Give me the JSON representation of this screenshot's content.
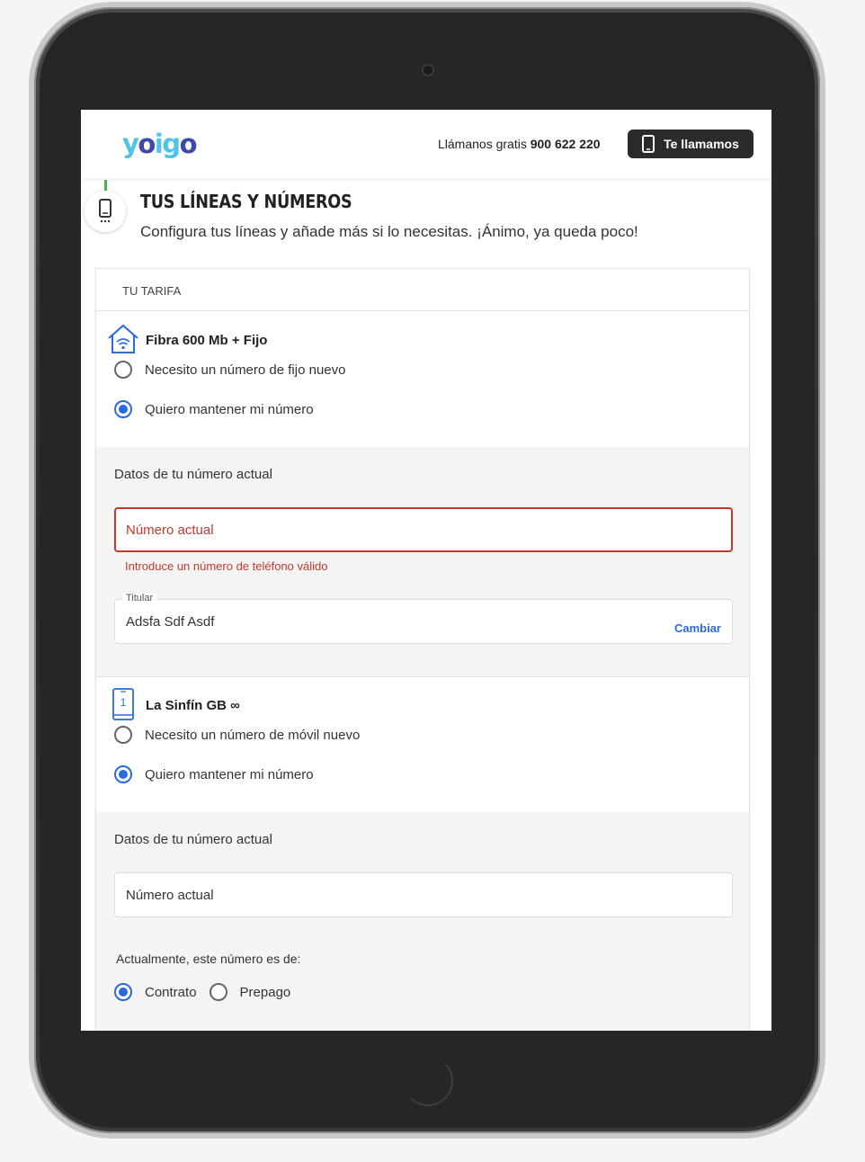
{
  "header": {
    "logo_text": "yoigo",
    "call_prefix": "Llámanos gratis",
    "call_number": "900 622 220",
    "callback_button": "Te llamamos"
  },
  "step": {
    "title": "TUS LÍNEAS Y NÚMEROS",
    "subtitle": "Configura tus líneas y añade más si lo necesitas. ¡Ánimo, ya queda poco!"
  },
  "card": {
    "header": "TU TARIFA",
    "fiber": {
      "title": "Fibra 600 Mb + Fijo",
      "option_new": "Necesito un número de fijo nuevo",
      "option_keep": "Quiero mantener mi número",
      "selected": "keep",
      "details_label": "Datos de tu número actual",
      "number_placeholder": "Número actual",
      "number_error": "Introduce un número de teléfono válido",
      "holder_legend": "Titular",
      "holder_value": "Adsfa Sdf Asdf",
      "holder_action": "Cambiar"
    },
    "mobile": {
      "title": "La Sinfín GB ∞",
      "icon_number": "1",
      "option_new": "Necesito un número de móvil nuevo",
      "option_keep": "Quiero mantener mi número",
      "selected": "keep",
      "details_label": "Datos de tu número actual",
      "number_placeholder": "Número actual",
      "type_label": "Actualmente, este número es de:",
      "type_contract": "Contrato",
      "type_prepaid": "Prepago",
      "type_selected": "contract"
    }
  },
  "colors": {
    "accent": "#2a6ad9",
    "error": "#c0392b",
    "progress": "#4caf50",
    "logo_light": "#4fc3e8",
    "logo_dark": "#3f4aa8"
  }
}
